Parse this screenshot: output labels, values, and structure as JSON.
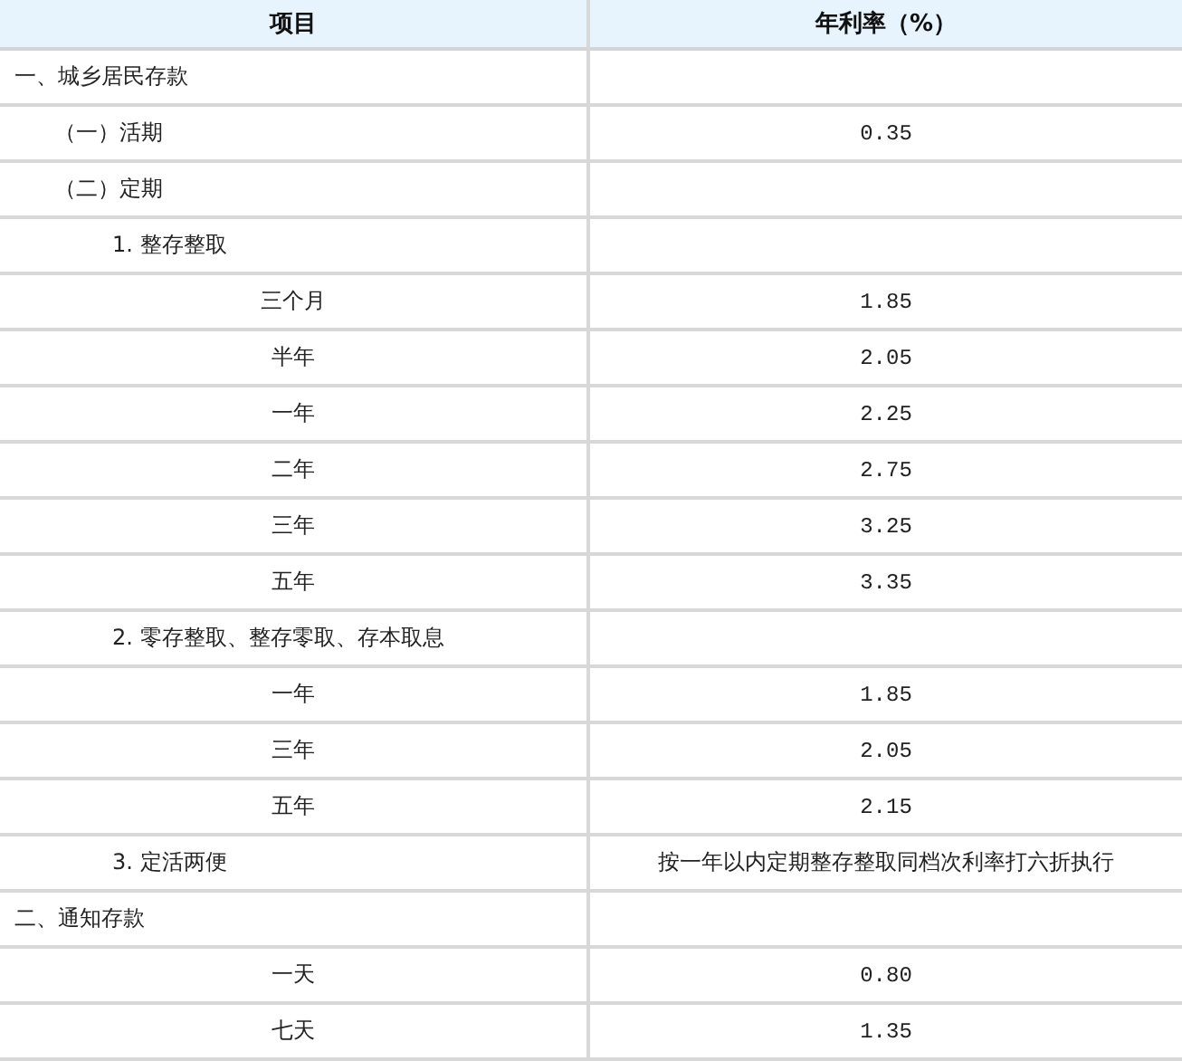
{
  "table": {
    "columns": [
      "项目",
      "年利率（%）"
    ],
    "rows": [
      {
        "label": "一、城乡居民存款",
        "kind": "section",
        "children": [
          {
            "label": "（一）活期",
            "kind": "section",
            "rate": "0.35"
          },
          {
            "label": "（二）定期",
            "kind": "section",
            "children": [
              {
                "label": "1. 整存整取",
                "kind": "section",
                "children": [
                  {
                    "label": "三个月",
                    "kind": "term",
                    "rate": "1.85"
                  },
                  {
                    "label": "半年",
                    "kind": "term",
                    "rate": "2.05"
                  },
                  {
                    "label": "一年",
                    "kind": "term",
                    "rate": "2.25"
                  },
                  {
                    "label": "二年",
                    "kind": "term",
                    "rate": "2.75"
                  },
                  {
                    "label": "三年",
                    "kind": "term",
                    "rate": "3.25"
                  },
                  {
                    "label": "五年",
                    "kind": "term",
                    "rate": "3.35"
                  }
                ]
              },
              {
                "label": "2. 零存整取、整存零取、存本取息",
                "kind": "section",
                "children": [
                  {
                    "label": "一年",
                    "kind": "term",
                    "rate": "1.85"
                  },
                  {
                    "label": "三年",
                    "kind": "term",
                    "rate": "2.05"
                  },
                  {
                    "label": "五年",
                    "kind": "term",
                    "rate": "2.15"
                  }
                ]
              },
              {
                "label": "3. 定活两便",
                "kind": "section",
                "rate": "按一年以内定期整存整取同档次利率打六折执行"
              }
            ]
          }
        ]
      },
      {
        "label": "二、通知存款",
        "kind": "section",
        "children": [
          {
            "label": "一天",
            "kind": "term",
            "rate": "0.80"
          },
          {
            "label": "七天",
            "kind": "term",
            "rate": "1.35"
          }
        ]
      }
    ]
  }
}
